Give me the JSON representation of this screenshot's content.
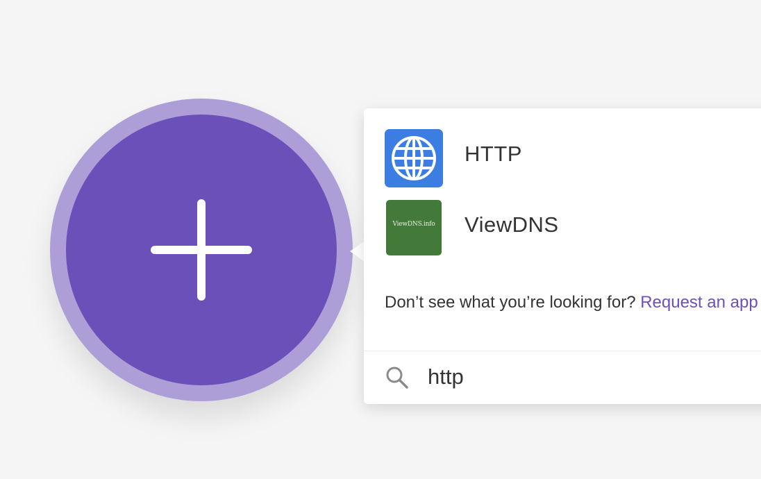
{
  "add_module": {
    "icon": "plus-icon"
  },
  "results": [
    {
      "name": "HTTP",
      "icon": "globe-icon",
      "logo_color": "#3b7de0"
    },
    {
      "name": "ViewDNS",
      "icon": "viewdns-logo",
      "logo_text": "ViewDNS.info",
      "logo_color": "#437a39"
    }
  ],
  "request": {
    "prompt": "Don’t see what you’re looking for? ",
    "link_label": "Request an app"
  },
  "search": {
    "icon": "search-icon",
    "value": "http"
  },
  "colors": {
    "accent": "#6c50b9",
    "accent_light": "#ad9ed8",
    "link": "#6d4fc0"
  }
}
